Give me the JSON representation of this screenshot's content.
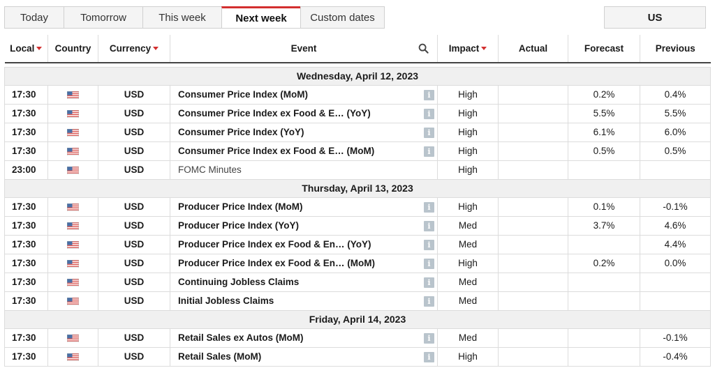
{
  "tabs": [
    {
      "label": "Today",
      "active": false
    },
    {
      "label": "Tomorrow",
      "active": false
    },
    {
      "label": "This week",
      "active": false
    },
    {
      "label": "Next week",
      "active": true
    },
    {
      "label": "Custom dates",
      "active": false
    }
  ],
  "country_button": "US",
  "columns": {
    "local": "Local",
    "country": "Country",
    "currency": "Currency",
    "event": "Event",
    "impact": "Impact",
    "actual": "Actual",
    "forecast": "Forecast",
    "previous": "Previous"
  },
  "icons": {
    "search": "search-icon",
    "info": "info-icon",
    "flag": "us-flag-icon",
    "sort": "sort-arrow-icon"
  },
  "colors": {
    "accent": "#d32f2f",
    "day_row_bg": "#f0f0f0",
    "info_icon": "#b9c4cc"
  },
  "days": [
    {
      "date": "Wednesday, April 12, 2023",
      "events": [
        {
          "time": "17:30",
          "currency": "USD",
          "event": "Consumer Price Index (MoM)",
          "impact": "High",
          "actual": "",
          "forecast": "0.2%",
          "previous": "0.4%",
          "bold": true
        },
        {
          "time": "17:30",
          "currency": "USD",
          "event": "Consumer Price Index ex Food & E…  (YoY)",
          "impact": "High",
          "actual": "",
          "forecast": "5.5%",
          "previous": "5.5%",
          "bold": true
        },
        {
          "time": "17:30",
          "currency": "USD",
          "event": "Consumer Price Index (YoY)",
          "impact": "High",
          "actual": "",
          "forecast": "6.1%",
          "previous": "6.0%",
          "bold": true
        },
        {
          "time": "17:30",
          "currency": "USD",
          "event": "Consumer Price Index ex Food & E…  (MoM)",
          "impact": "High",
          "actual": "",
          "forecast": "0.5%",
          "previous": "0.5%",
          "bold": true
        },
        {
          "time": "23:00",
          "currency": "USD",
          "event": "FOMC Minutes",
          "impact": "High",
          "actual": "",
          "forecast": "",
          "previous": "",
          "bold": false
        }
      ]
    },
    {
      "date": "Thursday, April 13, 2023",
      "events": [
        {
          "time": "17:30",
          "currency": "USD",
          "event": "Producer Price Index (MoM)",
          "impact": "High",
          "actual": "",
          "forecast": "0.1%",
          "previous": "-0.1%",
          "bold": true
        },
        {
          "time": "17:30",
          "currency": "USD",
          "event": "Producer Price Index (YoY)",
          "impact": "Med",
          "actual": "",
          "forecast": "3.7%",
          "previous": "4.6%",
          "bold": true
        },
        {
          "time": "17:30",
          "currency": "USD",
          "event": "Producer Price Index ex Food & En…  (YoY)",
          "impact": "Med",
          "actual": "",
          "forecast": "",
          "previous": "4.4%",
          "bold": true
        },
        {
          "time": "17:30",
          "currency": "USD",
          "event": "Producer Price Index ex Food & En…  (MoM)",
          "impact": "High",
          "actual": "",
          "forecast": "0.2%",
          "previous": "0.0%",
          "bold": true
        },
        {
          "time": "17:30",
          "currency": "USD",
          "event": "Continuing Jobless Claims",
          "impact": "Med",
          "actual": "",
          "forecast": "",
          "previous": "",
          "bold": true
        },
        {
          "time": "17:30",
          "currency": "USD",
          "event": "Initial Jobless Claims",
          "impact": "Med",
          "actual": "",
          "forecast": "",
          "previous": "",
          "bold": true
        }
      ]
    },
    {
      "date": "Friday, April 14, 2023",
      "events": [
        {
          "time": "17:30",
          "currency": "USD",
          "event": "Retail Sales ex Autos (MoM)",
          "impact": "Med",
          "actual": "",
          "forecast": "",
          "previous": "-0.1%",
          "bold": true
        },
        {
          "time": "17:30",
          "currency": "USD",
          "event": "Retail Sales (MoM)",
          "impact": "High",
          "actual": "",
          "forecast": "",
          "previous": "-0.4%",
          "bold": true
        }
      ]
    }
  ]
}
